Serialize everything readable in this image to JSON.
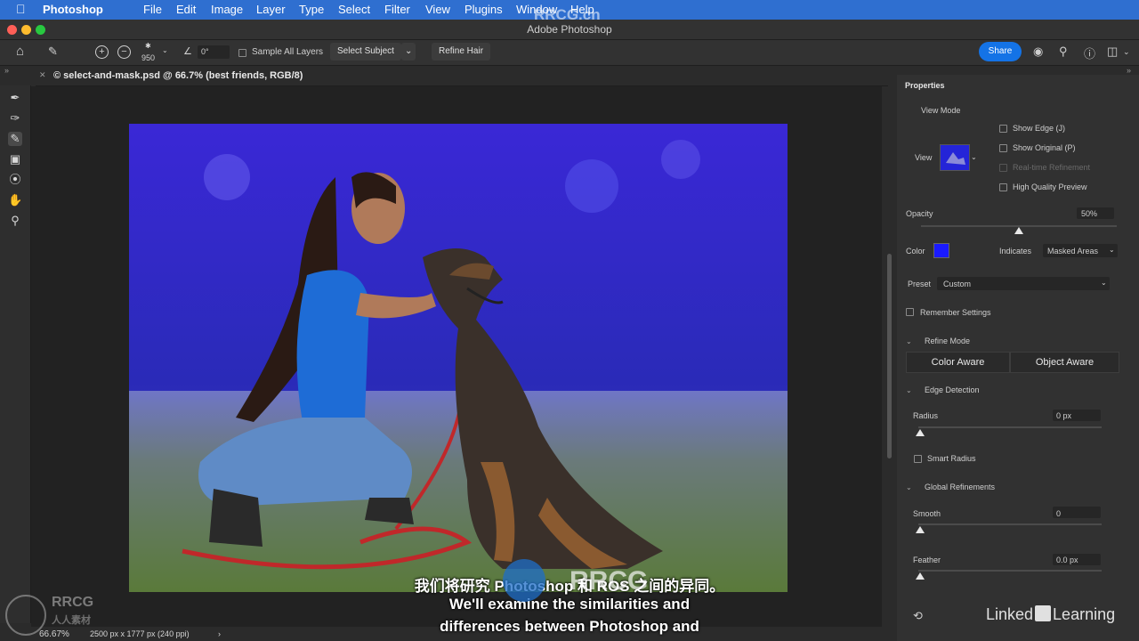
{
  "menubar": {
    "app": "Photoshop",
    "items": [
      "File",
      "Edit",
      "Image",
      "Layer",
      "Type",
      "Select",
      "Filter",
      "View",
      "Plugins",
      "Window",
      "Help"
    ]
  },
  "window": {
    "title": "Adobe Photoshop"
  },
  "options_bar": {
    "brush_size": "950",
    "angle": "0°",
    "sample_all_layers": "Sample All Layers",
    "select_subject": "Select Subject",
    "refine_hair": "Refine Hair",
    "share": "Share"
  },
  "document": {
    "tab_title": "© select-and-mask.psd @ 66.7% (best friends, RGB/8)"
  },
  "status": {
    "zoom": "66.67%",
    "dimensions": "2500 px x 1777 px (240 ppi)"
  },
  "properties": {
    "title": "Properties",
    "view_mode": "View Mode",
    "view_label": "View",
    "show_edge": "Show Edge (J)",
    "show_original": "Show Original (P)",
    "realtime_refinement": "Real-time Refinement",
    "high_quality_preview": "High Quality Preview",
    "opacity_label": "Opacity",
    "opacity_value": "50%",
    "opacity_fraction": 0.5,
    "color_label": "Color",
    "overlay_color": "#1a1aff",
    "indicates_label": "Indicates",
    "indicates_value": "Masked Areas",
    "preset_label": "Preset",
    "preset_value": "Custom",
    "remember_settings": "Remember Settings",
    "refine_mode": "Refine Mode",
    "color_aware": "Color Aware",
    "object_aware": "Object Aware",
    "edge_detection": "Edge Detection",
    "radius_label": "Radius",
    "radius_value": "0 px",
    "smart_radius": "Smart Radius",
    "global_refinements": "Global Refinements",
    "smooth_label": "Smooth",
    "smooth_value": "0",
    "feather_label": "Feather",
    "feather_value": "0.0 px"
  },
  "subtitles": {
    "line_cn": "我们将研究 Photoshop 和 ROS 之间的异同。",
    "line1": "We'll examine the similarities and",
    "line2": "differences between Photoshop and"
  },
  "watermarks": {
    "top": "RRCG.cn",
    "corner_top": "RRCG",
    "corner_bottom": "人人素材",
    "center": "RRCG",
    "brand_left": "Linked",
    "brand_right": "Learning"
  },
  "colors": {
    "menubar": "#2f6fd0",
    "accent": "#1473e6"
  }
}
